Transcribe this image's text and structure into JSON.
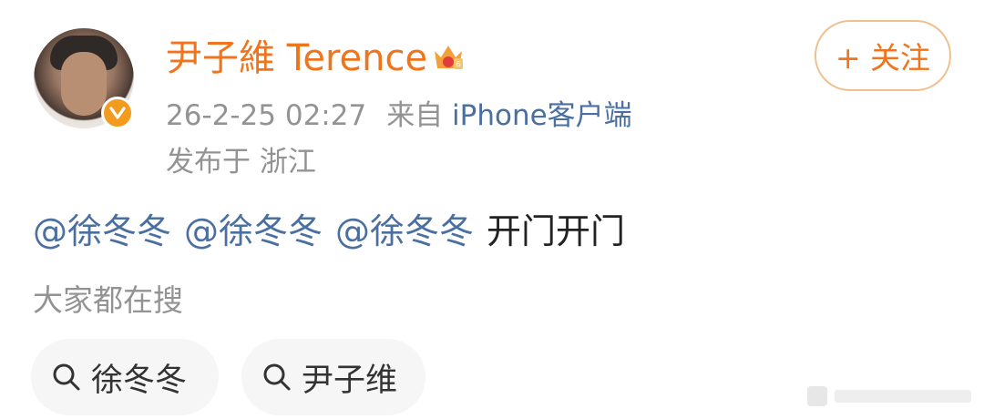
{
  "post": {
    "author": {
      "name": "尹子維 Terence",
      "avatar_icon": "avatar-photo",
      "verified_icon": "verified-v-icon",
      "vip_icon": "crown-vip-icon"
    },
    "meta": {
      "time": "26-2-25 02:27",
      "source_prefix": "来自",
      "source_link": "iPhone客户端",
      "location": "发布于 浙江"
    },
    "follow_button": "+ 关注",
    "content": {
      "mentions": [
        "@徐冬冬",
        "@徐冬冬",
        "@徐冬冬"
      ],
      "text": "开门开门"
    },
    "trending": {
      "title": "大家都在搜",
      "chips": [
        {
          "label": "徐冬冬",
          "icon": "search-icon"
        },
        {
          "label": "尹子维",
          "icon": "search-icon"
        }
      ]
    }
  },
  "colors": {
    "accent_orange": "#f0741c",
    "link_blue": "#4a6fa0",
    "meta_gray": "#939393",
    "chip_bg": "#f6f6f6"
  }
}
